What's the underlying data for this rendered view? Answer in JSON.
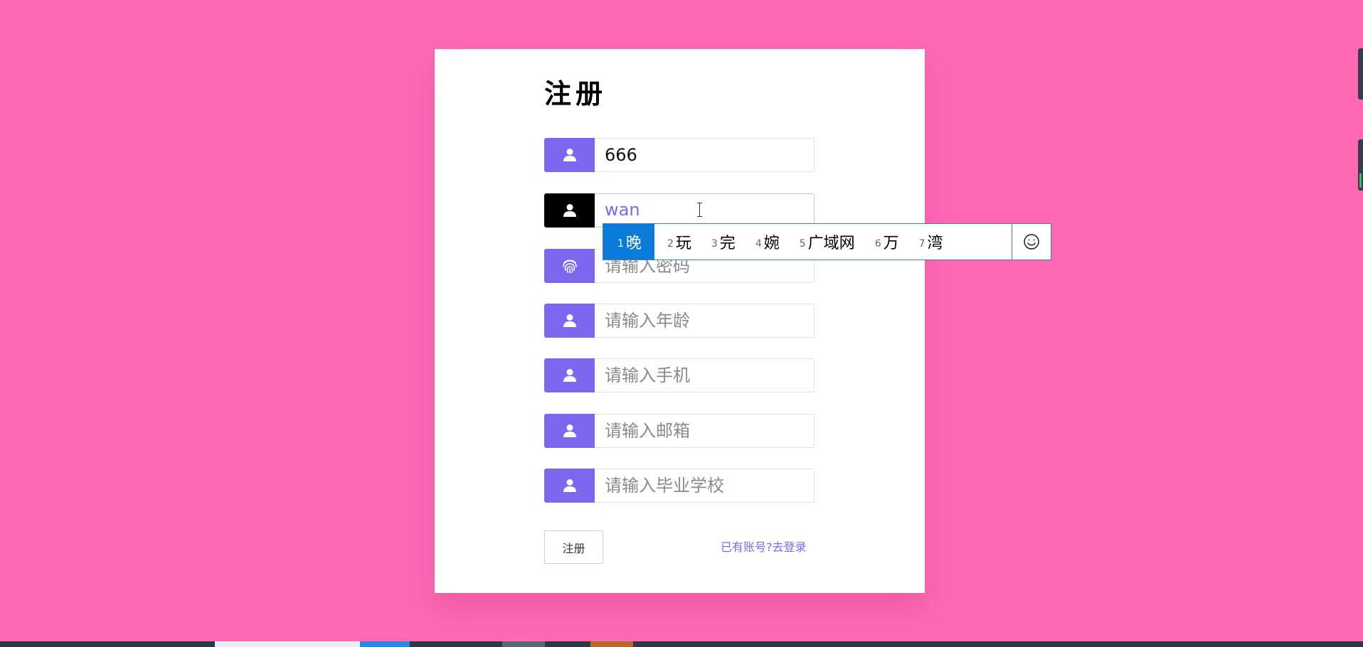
{
  "form": {
    "title": "注册",
    "fields": [
      {
        "value": "666",
        "placeholder": "",
        "icon": "user-icon"
      },
      {
        "value": "wan",
        "placeholder": "",
        "icon": "user-icon"
      },
      {
        "value": "",
        "placeholder": "请输入密码",
        "icon": "fingerprint-icon"
      },
      {
        "value": "",
        "placeholder": "请输入年龄",
        "icon": "user-icon"
      },
      {
        "value": "",
        "placeholder": "请输入手机",
        "icon": "user-icon"
      },
      {
        "value": "",
        "placeholder": "请输入邮箱",
        "icon": "user-icon"
      },
      {
        "value": "",
        "placeholder": "请输入毕业学校",
        "icon": "user-icon"
      }
    ],
    "submit_label": "注册",
    "login_link": "已有账号?去登录"
  },
  "ime": {
    "candidates": [
      {
        "num": "1",
        "text": "晚"
      },
      {
        "num": "2",
        "text": "玩"
      },
      {
        "num": "3",
        "text": "完"
      },
      {
        "num": "4",
        "text": "婉"
      },
      {
        "num": "5",
        "text": "广域网"
      },
      {
        "num": "6",
        "text": "万"
      },
      {
        "num": "7",
        "text": "湾"
      }
    ],
    "emoji_icon": "smiley-icon"
  },
  "colors": {
    "page_background": "#ff69b4",
    "accent": "#7b68ee",
    "active_icon": "#000000",
    "ime_highlight": "#0a7bd8"
  }
}
